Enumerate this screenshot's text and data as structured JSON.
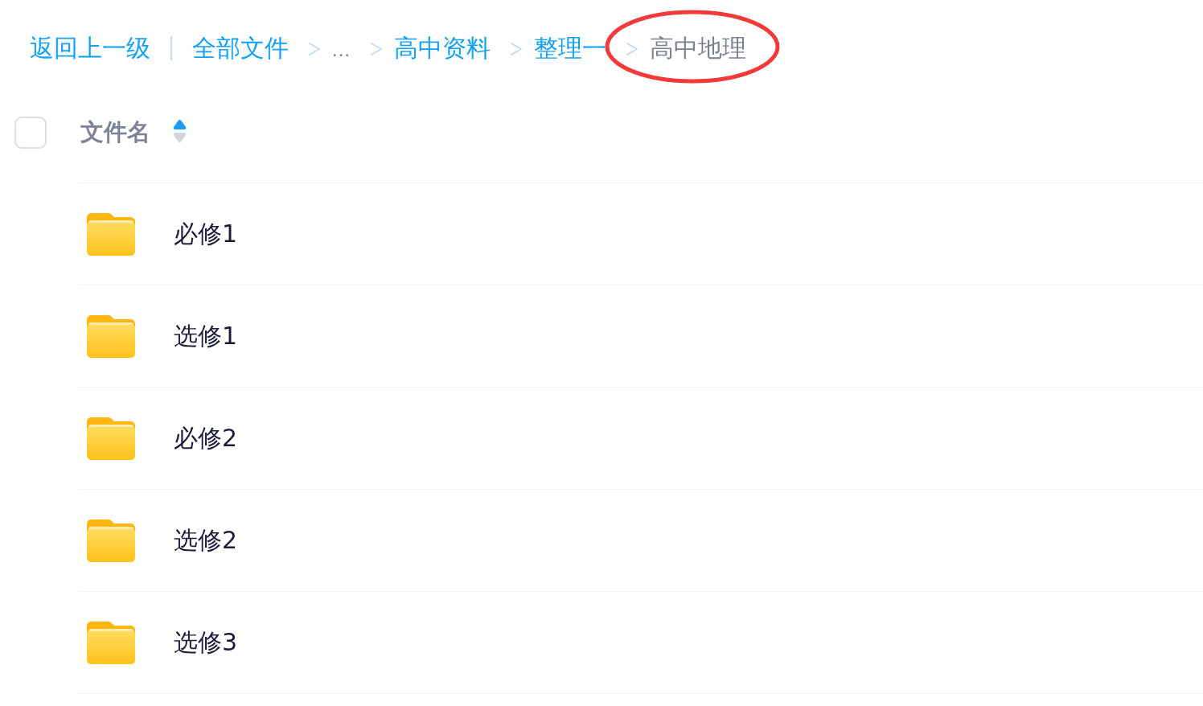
{
  "breadcrumb": {
    "back": "返回上一级",
    "items": [
      {
        "label": "全部文件",
        "kind": "link",
        "circled": false
      },
      {
        "label": "...",
        "kind": "ellipsis",
        "circled": false
      },
      {
        "label": "高中资料",
        "kind": "link",
        "circled": false
      },
      {
        "label": "整理一",
        "kind": "link",
        "circled": false
      },
      {
        "label": "高中地理",
        "kind": "current",
        "circled": true
      }
    ]
  },
  "header": {
    "checked": false,
    "title": "文件名",
    "ascending": true
  },
  "files": [
    {
      "name": "必修1",
      "kind": "folder"
    },
    {
      "name": "选修1",
      "kind": "folder"
    },
    {
      "name": "必修2",
      "kind": "folder"
    },
    {
      "name": "选修2",
      "kind": "folder"
    },
    {
      "name": "选修3",
      "kind": "folder"
    }
  ]
}
